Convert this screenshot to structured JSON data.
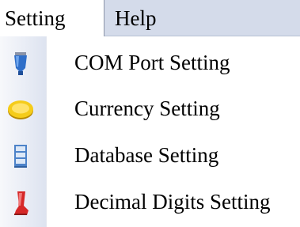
{
  "menubar": {
    "menus": [
      {
        "label": "Setting"
      },
      {
        "label": "Help"
      }
    ]
  },
  "dropdown": {
    "items": [
      {
        "label": "COM Port Setting",
        "icon": "com-port-icon"
      },
      {
        "label": "Currency Setting",
        "icon": "coin-icon"
      },
      {
        "label": "Database Setting",
        "icon": "database-icon"
      },
      {
        "label": "Decimal Digits Setting",
        "icon": "decimal-digits-icon"
      }
    ]
  },
  "colors": {
    "menubar_bg": "#d4dbea",
    "gutter_bg": "#e8ecf5",
    "text": "#000000"
  }
}
